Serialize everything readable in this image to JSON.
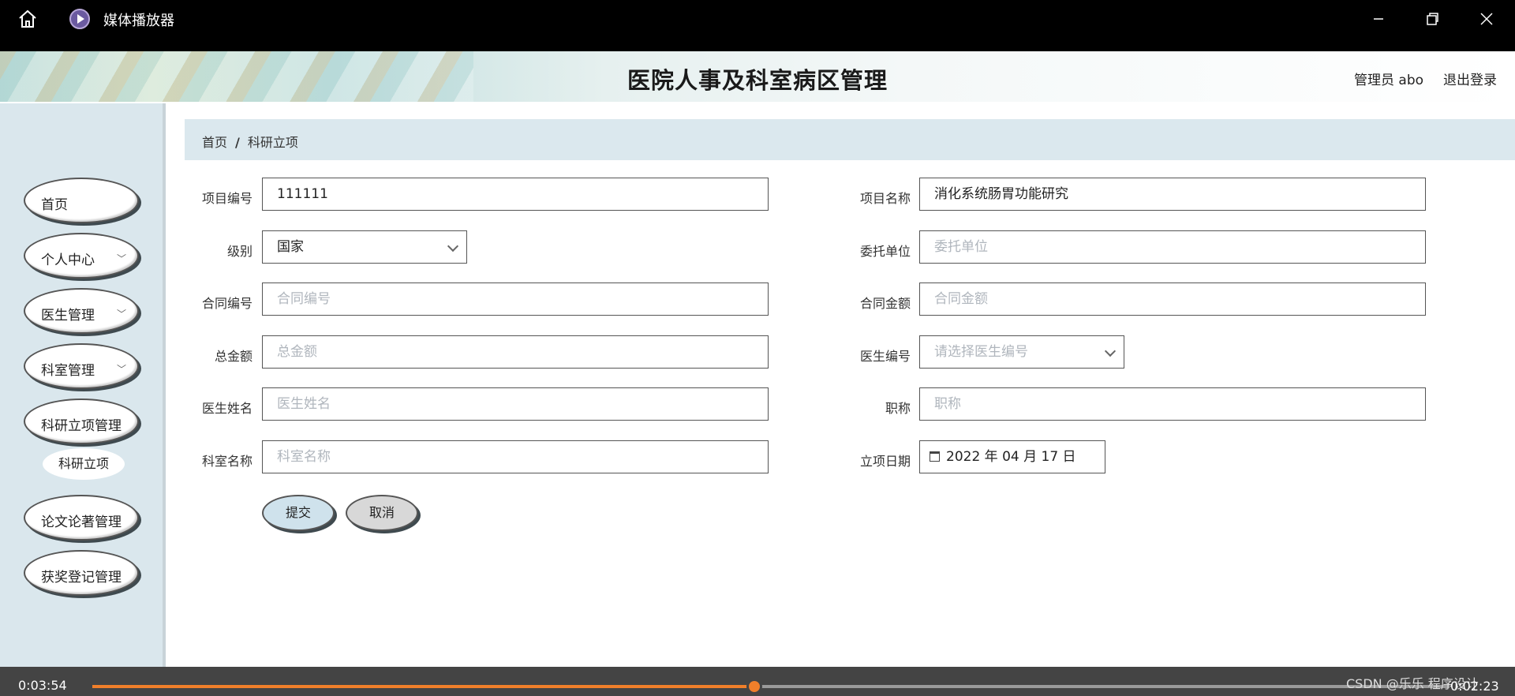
{
  "player": {
    "title": "媒体播放器",
    "time_elapsed": "0:03:54",
    "time_remaining": "0:02:23",
    "progress_fraction": 0.488,
    "watermark": "CSDN @乐乐 程序设计",
    "accent_color": "#f07f2a"
  },
  "site": {
    "title": "医院人事及科室病区管理",
    "user": "管理员 abo",
    "logout": "退出登录"
  },
  "sidebar": {
    "items": [
      {
        "label": "首页",
        "has_chevron": false
      },
      {
        "label": "个人中心",
        "has_chevron": true
      },
      {
        "label": "医生管理",
        "has_chevron": true
      },
      {
        "label": "科室管理",
        "has_chevron": true
      },
      {
        "label": "科研立项管理",
        "has_chevron": false
      },
      {
        "label": "论文论著管理",
        "has_chevron": false
      },
      {
        "label": "获奖登记管理",
        "has_chevron": false
      }
    ],
    "sub_item": "科研立项"
  },
  "breadcrumb": {
    "home": "首页",
    "sep": "/",
    "current": "科研立项"
  },
  "form": {
    "project_no": {
      "label": "项目编号",
      "value": "111111"
    },
    "project_name": {
      "label": "项目名称",
      "value": "消化系统肠胃功能研究"
    },
    "level": {
      "label": "级别",
      "value": "国家"
    },
    "client": {
      "label": "委托单位",
      "placeholder": "委托单位"
    },
    "contract_no": {
      "label": "合同编号",
      "placeholder": "合同编号"
    },
    "contract_amount": {
      "label": "合同金额",
      "placeholder": "合同金额"
    },
    "total_amount": {
      "label": "总金额",
      "placeholder": "总金额"
    },
    "doctor_no": {
      "label": "医生编号",
      "placeholder": "请选择医生编号"
    },
    "doctor_name": {
      "label": "医生姓名",
      "placeholder": "医生姓名"
    },
    "title": {
      "label": "职称",
      "placeholder": "职称"
    },
    "dept_name": {
      "label": "科室名称",
      "placeholder": "科室名称"
    },
    "date": {
      "label": "立项日期",
      "value": "2022 年 04 月 17 日"
    },
    "submit": "提交",
    "cancel": "取消"
  }
}
